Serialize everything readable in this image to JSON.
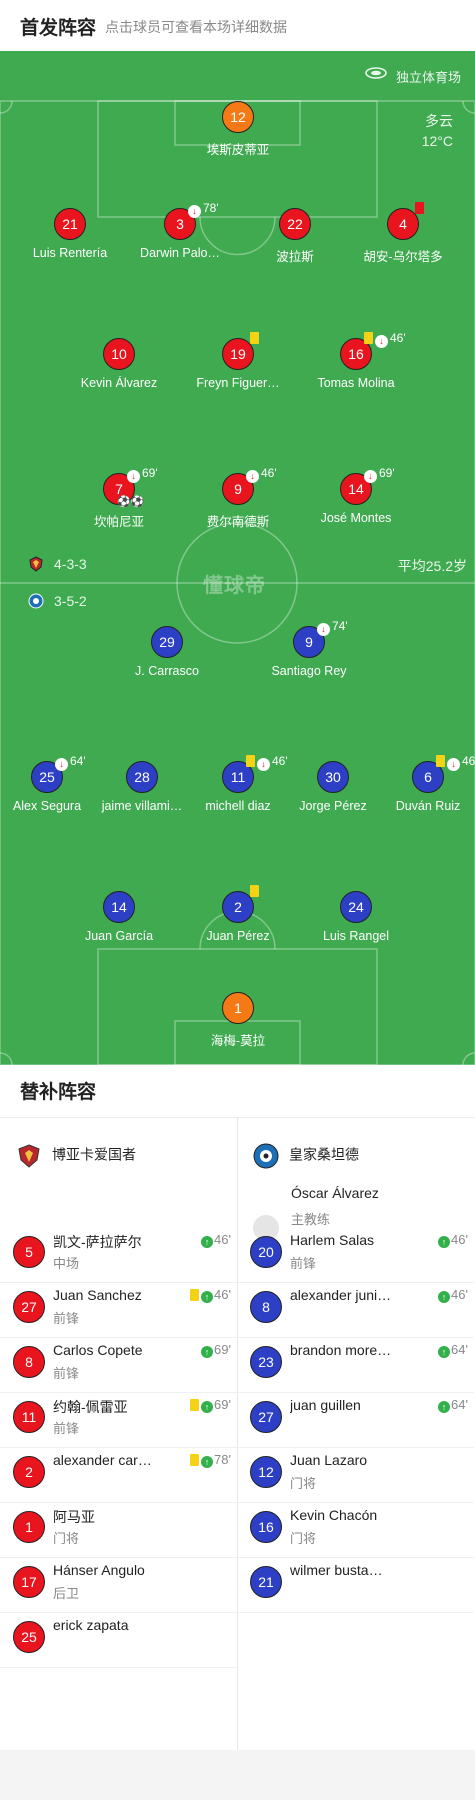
{
  "header": {
    "title": "首发阵容",
    "subtitle": "点击球员可查看本场详细数据"
  },
  "pitch": {
    "venue": "独立体育场",
    "weather": "多云",
    "temperature": "12°C",
    "home_formation": "4-3-3",
    "away_formation": "3-5-2",
    "avg_age": "平均25.2岁",
    "watermark": "懂球帝"
  },
  "home_players": [
    {
      "num": "12",
      "name": "埃斯皮蒂亚",
      "color": "orange",
      "events": ""
    },
    {
      "num": "21",
      "name": "Luis Rentería",
      "color": "red",
      "events": ""
    },
    {
      "num": "3",
      "name": "Darwin Palo…",
      "color": "red",
      "events": "78'"
    },
    {
      "num": "22",
      "name": "波拉斯",
      "color": "red",
      "events": ""
    },
    {
      "num": "4",
      "name": "胡安-乌尔塔多",
      "color": "red",
      "events": ""
    },
    {
      "num": "10",
      "name": "Kevin Álvarez",
      "color": "red",
      "events": ""
    },
    {
      "num": "19",
      "name": "Freyn Figuer…",
      "color": "red",
      "events": ""
    },
    {
      "num": "16",
      "name": "Tomas Molina",
      "color": "red",
      "events": "46'"
    },
    {
      "num": "7",
      "name": "坎帕尼亚",
      "color": "red",
      "events": "69'",
      "goals": "⚽⚽"
    },
    {
      "num": "9",
      "name": "费尔南德斯",
      "color": "red",
      "events": "46'"
    },
    {
      "num": "14",
      "name": "José Montes",
      "color": "red",
      "events": "69'"
    }
  ],
  "away_players": [
    {
      "num": "29",
      "name": "J. Carrasco",
      "color": "blue",
      "events": ""
    },
    {
      "num": "9",
      "name": "Santiago Rey",
      "color": "blue",
      "events": "74'"
    },
    {
      "num": "25",
      "name": "Alex Segura",
      "color": "blue",
      "events": "64'"
    },
    {
      "num": "28",
      "name": "jaime villami…",
      "color": "blue",
      "events": ""
    },
    {
      "num": "11",
      "name": "michell diaz",
      "color": "blue",
      "events": "46'"
    },
    {
      "num": "30",
      "name": "Jorge Pérez",
      "color": "blue",
      "events": ""
    },
    {
      "num": "6",
      "name": "Duván Ruiz",
      "color": "blue",
      "events": "46"
    },
    {
      "num": "14",
      "name": "Juan García",
      "color": "blue",
      "events": ""
    },
    {
      "num": "2",
      "name": "Juan Pérez",
      "color": "blue",
      "events": ""
    },
    {
      "num": "24",
      "name": "Luis Rangel",
      "color": "blue",
      "events": ""
    },
    {
      "num": "1",
      "name": "海梅-莫拉",
      "color": "orange",
      "events": ""
    }
  ],
  "subs": {
    "title": "替补阵容",
    "home_team": "博亚卡爱国者",
    "away_team": "皇家桑坦德",
    "away_coach": {
      "name": "Óscar Álvarez",
      "role": "主教练"
    },
    "home": [
      {
        "num": "5",
        "name": "凯文-萨拉萨尔",
        "pos": "中场",
        "minute": "46'"
      },
      {
        "num": "27",
        "name": "Juan Sanchez",
        "pos": "前锋",
        "minute": "46'"
      },
      {
        "num": "8",
        "name": "Carlos Copete",
        "pos": "前锋",
        "minute": "69'"
      },
      {
        "num": "11",
        "name": "约翰-佩雷亚",
        "pos": "前锋",
        "minute": "69'"
      },
      {
        "num": "2",
        "name": "alexander car…",
        "pos": "",
        "minute": "78'"
      },
      {
        "num": "1",
        "name": "阿马亚",
        "pos": "门将",
        "minute": ""
      },
      {
        "num": "17",
        "name": "Hánser Angulo",
        "pos": "后卫",
        "minute": ""
      },
      {
        "num": "25",
        "name": "erick zapata",
        "pos": "",
        "minute": ""
      }
    ],
    "away": [
      {
        "num": "20",
        "name": "Harlem Salas",
        "pos": "前锋",
        "minute": "46'"
      },
      {
        "num": "8",
        "name": "alexander juni…",
        "pos": "",
        "minute": "46'"
      },
      {
        "num": "23",
        "name": "brandon more…",
        "pos": "",
        "minute": "64'"
      },
      {
        "num": "27",
        "name": "juan guillen",
        "pos": "",
        "minute": "64'"
      },
      {
        "num": "12",
        "name": "Juan Lazaro",
        "pos": "门将",
        "minute": ""
      },
      {
        "num": "16",
        "name": "Kevin Chacón",
        "pos": "门将",
        "minute": ""
      },
      {
        "num": "21",
        "name": "wilmer busta…",
        "pos": "",
        "minute": ""
      }
    ]
  },
  "colors": {
    "pitch": "#3faa50",
    "home": "#e8141e",
    "away": "#2d3fc4",
    "keeper": "#f57a16"
  }
}
